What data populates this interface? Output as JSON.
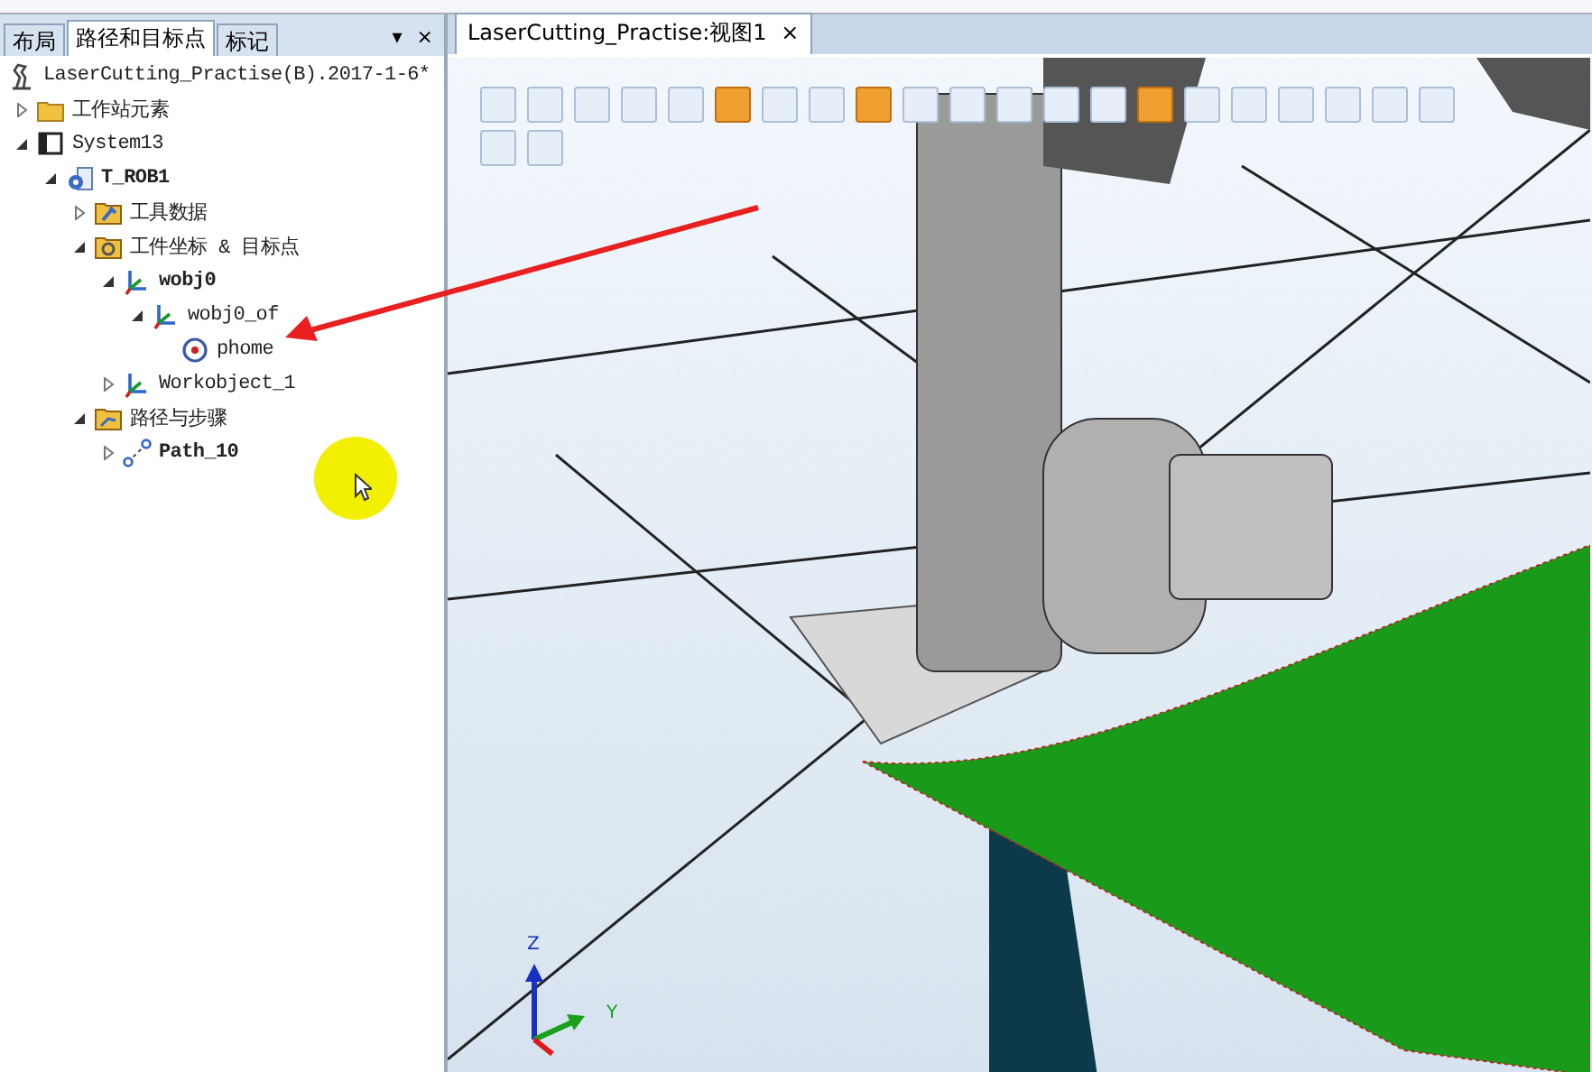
{
  "panel": {
    "tabs": [
      {
        "label": "布局",
        "selected": false
      },
      {
        "label": "路径和目标点",
        "selected": true
      },
      {
        "label": "标记",
        "selected": false
      }
    ],
    "pin": "▾",
    "close": "×",
    "tree": [
      {
        "label": "LaserCutting_Practise(B).2017-1-6*",
        "kind": "station",
        "bold": false,
        "children": [
          {
            "label": "工作站元素",
            "kind": "folder",
            "bold": false,
            "expanded": false
          },
          {
            "label": "System13",
            "kind": "system",
            "bold": false,
            "expanded": true,
            "children": [
              {
                "label": "T_ROB1",
                "kind": "task",
                "bold": true,
                "expanded": true,
                "children": [
                  {
                    "label": "工具数据",
                    "kind": "tooldata",
                    "bold": false,
                    "expanded": false
                  },
                  {
                    "label": "工件坐标 & 目标点",
                    "kind": "wobjfolder",
                    "bold": false,
                    "expanded": true,
                    "children": [
                      {
                        "label": "wobj0",
                        "kind": "frame",
                        "bold": true,
                        "expanded": true,
                        "children": [
                          {
                            "label": "wobj0_of",
                            "kind": "frame",
                            "bold": false,
                            "expanded": true,
                            "children": [
                              {
                                "label": "phome",
                                "kind": "target",
                                "bold": false
                              }
                            ]
                          }
                        ]
                      },
                      {
                        "label": "Workobject_1",
                        "kind": "frame",
                        "bold": false,
                        "expanded": false
                      }
                    ]
                  },
                  {
                    "label": "路径与步骤",
                    "kind": "pathfolder",
                    "bold": false,
                    "expanded": true,
                    "children": [
                      {
                        "label": "Path_10",
                        "kind": "path",
                        "bold": true,
                        "expanded": false
                      }
                    ]
                  }
                ]
              }
            ]
          }
        ]
      }
    ]
  },
  "view": {
    "tab": {
      "label": "LaserCutting_Practise:视图1",
      "close": "×"
    },
    "toolbar": [
      [
        {
          "active": false
        },
        {
          "active": false
        },
        {
          "active": false
        },
        {
          "active": false
        },
        {
          "active": false
        },
        {
          "active": true
        },
        {
          "active": false
        },
        {
          "active": false
        },
        {
          "active": true
        },
        {
          "active": false
        },
        {
          "active": false
        },
        {
          "active": false
        },
        {
          "active": false
        },
        {
          "active": false
        },
        {
          "active": true
        },
        {
          "active": false
        },
        {
          "active": false
        },
        {
          "active": false
        },
        {
          "active": false
        },
        {
          "active": false
        },
        {
          "active": false
        }
      ],
      [
        {
          "active": false
        },
        {
          "active": false
        }
      ]
    ],
    "axes": {
      "z": "Z",
      "y": "Y"
    }
  }
}
